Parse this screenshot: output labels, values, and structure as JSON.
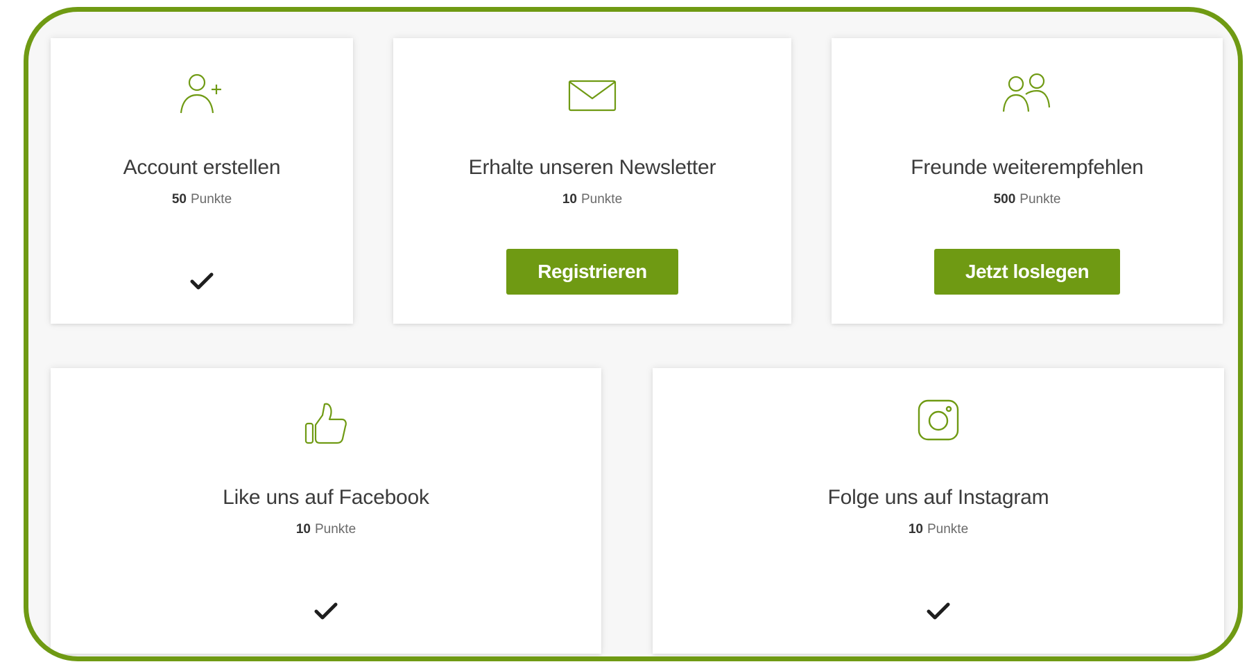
{
  "accent_color": "#6f9a13",
  "cards": [
    {
      "icon": "add-user-icon",
      "title": "Account erstellen",
      "points_value": "50",
      "points_label": "Punkte",
      "status": "completed"
    },
    {
      "icon": "envelope-icon",
      "title": "Erhalte unseren Newsletter",
      "points_value": "10",
      "points_label": "Punkte",
      "button_label": "Registrieren"
    },
    {
      "icon": "users-icon",
      "title": "Freunde weiterempfehlen",
      "points_value": "500",
      "points_label": "Punkte",
      "button_label": "Jetzt loslegen"
    },
    {
      "icon": "thumbs-up-icon",
      "title": "Like uns auf Facebook",
      "points_value": "10",
      "points_label": "Punkte",
      "status": "completed"
    },
    {
      "icon": "instagram-icon",
      "title": "Folge uns auf Instagram",
      "points_value": "10",
      "points_label": "Punkte",
      "status": "completed"
    }
  ]
}
